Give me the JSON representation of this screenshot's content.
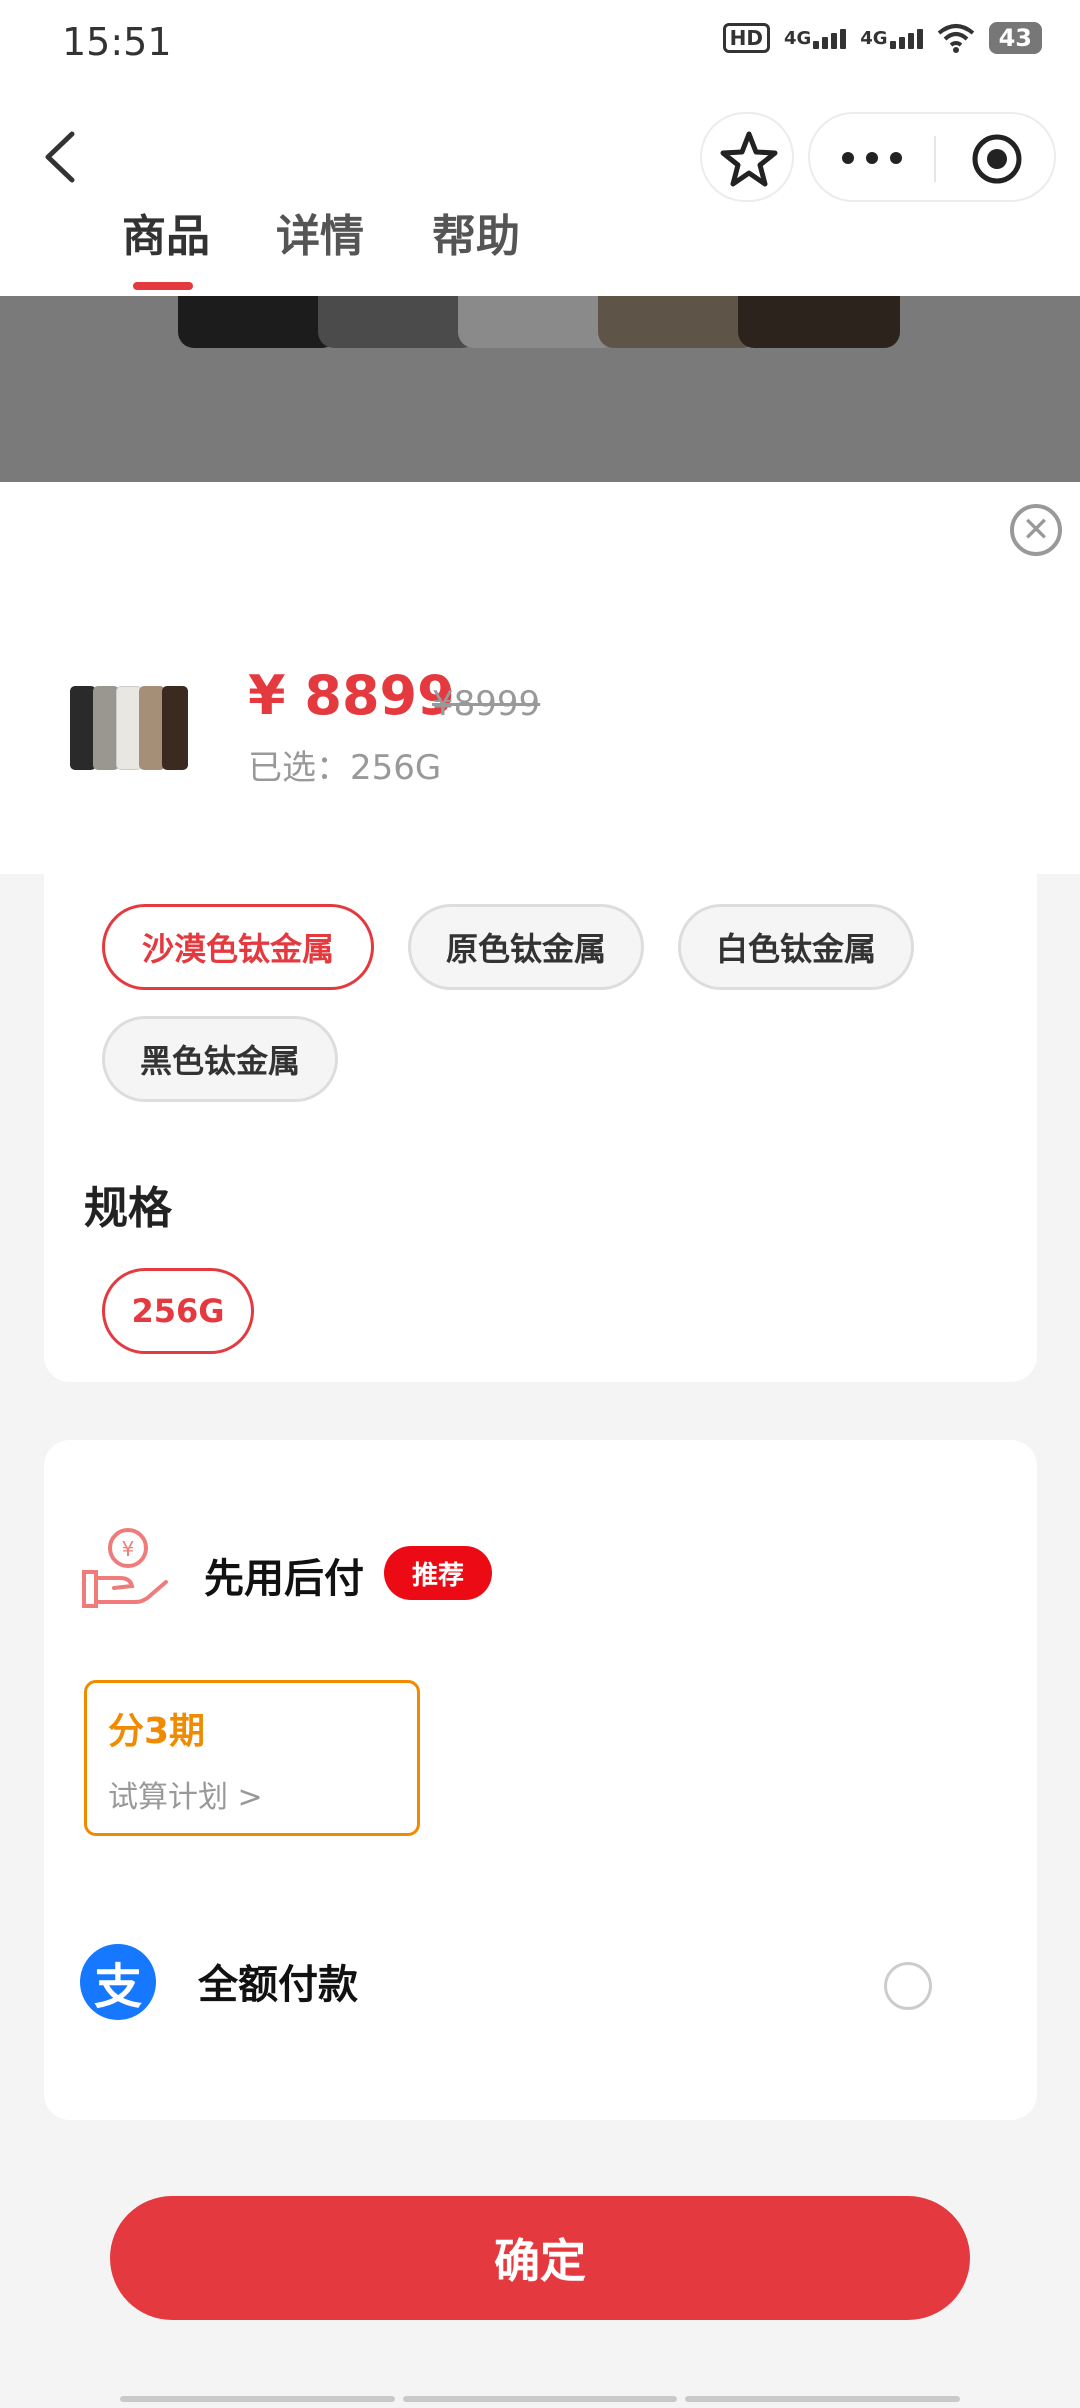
{
  "status_bar": {
    "time": "15:51",
    "hd": "HD",
    "net1": "4G",
    "net2": "4G",
    "battery": "43"
  },
  "header": {
    "tabs": [
      "商品",
      "详情",
      "帮助"
    ],
    "active_tab": 0
  },
  "sku": {
    "price": "¥ 8899",
    "original_price": "¥8999",
    "selected": "已选：256G",
    "colors": [
      "沙漠色钛金属",
      "原色钛金属",
      "白色钛金属",
      "黑色钛金属"
    ],
    "selected_color": 0,
    "spec_label": "规格",
    "specs": [
      "256G"
    ],
    "selected_spec": 0
  },
  "payment": {
    "bnpl_title": "先用后付",
    "bnpl_badge": "推荐",
    "plan_title": "分3期",
    "plan_sub": "试算计划 >",
    "full_pay_label": "全额付款",
    "alipay_glyph": "支"
  },
  "confirm_label": "确定",
  "colors": {
    "accent": "#e43a3f",
    "badge": "#ec0a14",
    "plan": "#f08a00",
    "alipay": "#1677ff"
  }
}
